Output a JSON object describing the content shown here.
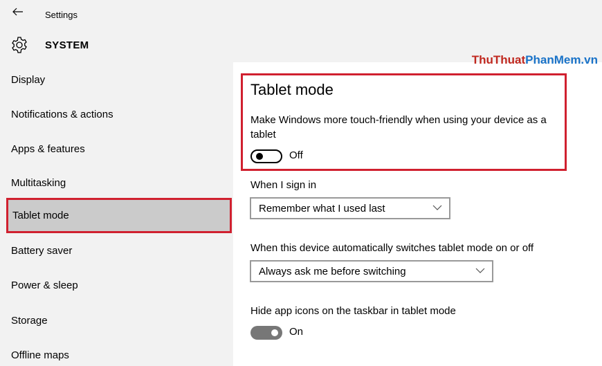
{
  "titlebar": {
    "title": "Settings",
    "back_icon": "back-arrow-icon"
  },
  "header": {
    "title": "SYSTEM",
    "icon": "gear-icon"
  },
  "watermark": {
    "part1": "ThuThuat",
    "part2": "PhanMem.vn"
  },
  "sidebar": {
    "items": [
      {
        "label": "Display"
      },
      {
        "label": "Notifications & actions"
      },
      {
        "label": "Apps & features"
      },
      {
        "label": "Multitasking"
      },
      {
        "label": "Tablet mode",
        "selected": true
      },
      {
        "label": "Battery saver"
      },
      {
        "label": "Power & sleep"
      },
      {
        "label": "Storage"
      },
      {
        "label": "Offline maps"
      }
    ]
  },
  "main": {
    "title": "Tablet mode",
    "description": "Make Windows more touch-friendly when using your device as a tablet",
    "tablet_toggle": {
      "state": "Off"
    },
    "sign_in": {
      "label": "When I sign in",
      "selected": "Remember what I used last"
    },
    "switch_behavior": {
      "label": "When this device automatically switches tablet mode on or off",
      "selected": "Always ask me before switching"
    },
    "hide_icons": {
      "label": "Hide app icons on the taskbar in tablet mode",
      "state": "On"
    }
  },
  "colors": {
    "accent_red": "#d0202f",
    "sidebar_bg": "#f2f2f2",
    "selected_bg": "#cbcbcb"
  }
}
